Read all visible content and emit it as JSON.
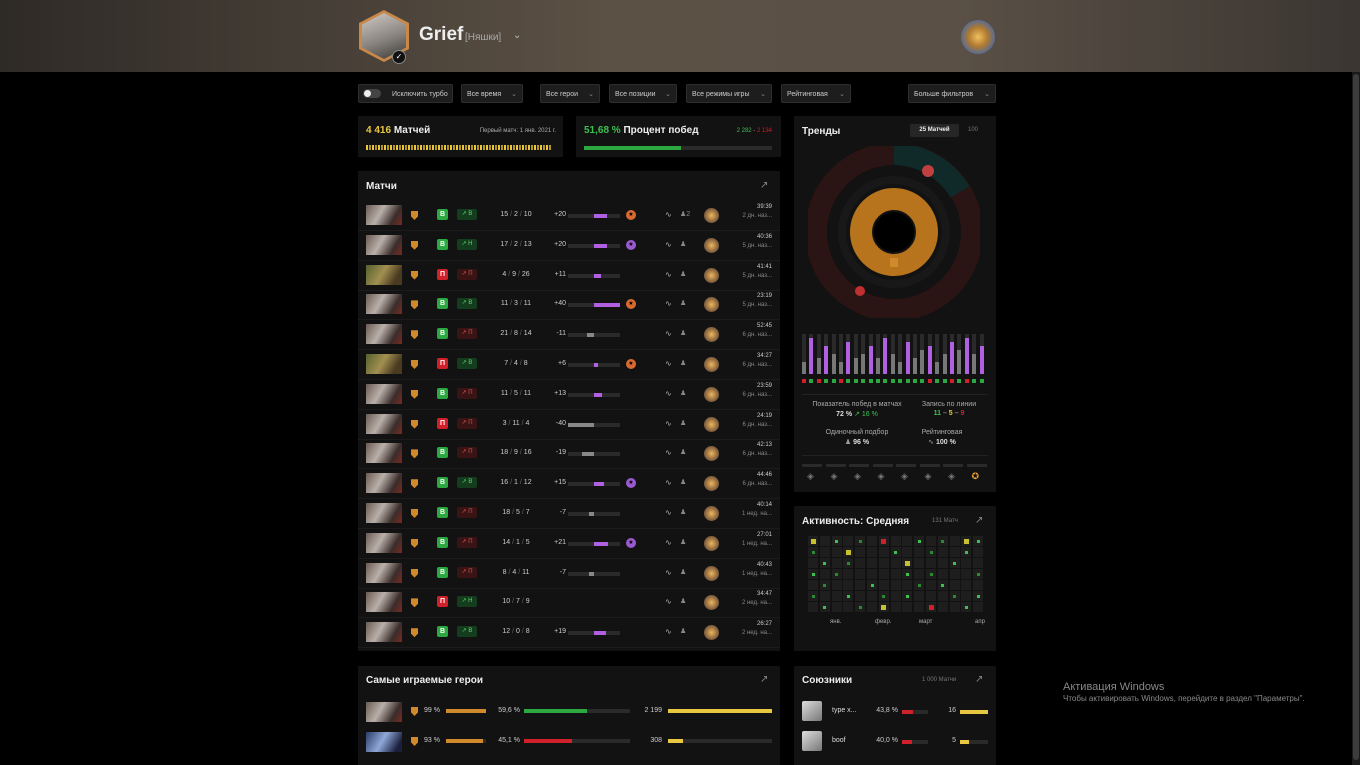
{
  "header": {
    "name": "Grief",
    "team": "[Няшки]"
  },
  "filters": {
    "turbo": "Исключить турбо",
    "time": "Все время",
    "heroes": "Все герои",
    "positions": "Все позиции",
    "modes": "Все режимы игры",
    "lobby": "Рейтинговая",
    "more": "Больше фильтров"
  },
  "summary": {
    "matches_count": "4 416",
    "matches_label": "Матчей",
    "first_match": "Первый матч: 1 янв. 2021 г.",
    "winrate": "51,68 %",
    "winrate_label": "Процент побед",
    "wins": "2 282",
    "losses": "2 134",
    "winrate_fraction": 0.5168
  },
  "matches": {
    "title": "Матчи",
    "rows": [
      {
        "hero": "p",
        "result": "В",
        "lane": "В",
        "lane_res": "w",
        "k": "15",
        "d": "2",
        "a": "10",
        "imp": "+20",
        "imp_value": 20,
        "badge": "#d86a30",
        "party": "2",
        "dur": "39:39",
        "ago": "2 дн. наз..."
      },
      {
        "hero": "p",
        "result": "В",
        "lane": "Н",
        "lane_res": "w",
        "k": "17",
        "d": "2",
        "a": "13",
        "imp": "+20",
        "imp_value": 20,
        "badge": "#9b59d0",
        "party": "",
        "dur": "40:36",
        "ago": "5 дн. наз..."
      },
      {
        "hero": "g",
        "result": "П",
        "lane": "П",
        "lane_res": "l",
        "k": "4",
        "d": "9",
        "a": "26",
        "imp": "+11",
        "imp_value": 11,
        "badge": "",
        "party": "",
        "dur": "41:41",
        "ago": "5 дн. наз..."
      },
      {
        "hero": "p",
        "result": "В",
        "lane": "В",
        "lane_res": "w",
        "k": "11",
        "d": "3",
        "a": "11",
        "imp": "+40",
        "imp_value": 40,
        "badge": "#d86a30",
        "party": "",
        "dur": "23:19",
        "ago": "5 дн. наз..."
      },
      {
        "hero": "p",
        "result": "В",
        "lane": "П",
        "lane_res": "l",
        "k": "21",
        "d": "8",
        "a": "14",
        "imp": "-11",
        "imp_value": -11,
        "badge": "",
        "party": "",
        "dur": "52:45",
        "ago": "6 дн. наз..."
      },
      {
        "hero": "g",
        "result": "П",
        "lane": "В",
        "lane_res": "w",
        "k": "7",
        "d": "4",
        "a": "8",
        "imp": "+6",
        "imp_value": 6,
        "badge": "#d86a30",
        "party": "",
        "dur": "34:27",
        "ago": "6 дн. наз..."
      },
      {
        "hero": "p",
        "result": "В",
        "lane": "П",
        "lane_res": "l",
        "k": "11",
        "d": "5",
        "a": "11",
        "imp": "+13",
        "imp_value": 13,
        "badge": "",
        "party": "",
        "dur": "23:59",
        "ago": "6 дн. наз..."
      },
      {
        "hero": "p",
        "result": "П",
        "lane": "П",
        "lane_res": "l",
        "k": "3",
        "d": "11",
        "a": "4",
        "imp": "-40",
        "imp_value": -40,
        "badge": "",
        "party": "",
        "dur": "24:19",
        "ago": "6 дн. наз..."
      },
      {
        "hero": "p",
        "result": "В",
        "lane": "П",
        "lane_res": "l",
        "k": "18",
        "d": "9",
        "a": "16",
        "imp": "-19",
        "imp_value": -19,
        "badge": "",
        "party": "",
        "dur": "42:13",
        "ago": "6 дн. наз..."
      },
      {
        "hero": "p",
        "result": "В",
        "lane": "В",
        "lane_res": "w",
        "k": "16",
        "d": "1",
        "a": "12",
        "imp": "+15",
        "imp_value": 15,
        "badge": "#9b59d0",
        "party": "",
        "dur": "44:46",
        "ago": "6 дн. наз..."
      },
      {
        "hero": "p",
        "result": "В",
        "lane": "П",
        "lane_res": "l",
        "k": "18",
        "d": "5",
        "a": "7",
        "imp": "-7",
        "imp_value": -7,
        "badge": "",
        "party": "",
        "dur": "40:14",
        "ago": "1 нед. на..."
      },
      {
        "hero": "p",
        "result": "В",
        "lane": "П",
        "lane_res": "l",
        "k": "14",
        "d": "1",
        "a": "5",
        "imp": "+21",
        "imp_value": 21,
        "badge": "#9b59d0",
        "party": "",
        "dur": "27:01",
        "ago": "1 нед. на..."
      },
      {
        "hero": "p",
        "result": "В",
        "lane": "П",
        "lane_res": "l",
        "k": "8",
        "d": "4",
        "a": "11",
        "imp": "-7",
        "imp_value": -7,
        "badge": "",
        "party": "",
        "dur": "40:43",
        "ago": "1 нед. на..."
      },
      {
        "hero": "p",
        "result": "П",
        "lane": "Н",
        "lane_res": "w",
        "k": "10",
        "d": "7",
        "a": "9",
        "imp": "",
        "imp_value": 0,
        "badge": "",
        "party": "",
        "dur": "34:47",
        "ago": "2 нед. на..."
      },
      {
        "hero": "p",
        "result": "В",
        "lane": "В",
        "lane_res": "w",
        "k": "12",
        "d": "0",
        "a": "8",
        "imp": "+19",
        "imp_value": 19,
        "badge": "",
        "party": "",
        "dur": "26:27",
        "ago": "2 нед. на..."
      }
    ]
  },
  "heroes": {
    "title": "Самые играемые герои",
    "rows": [
      {
        "hero": "p",
        "pct": "99 %",
        "pct_value": 0.99,
        "wr": "59,6 %",
        "wr_value": 0.596,
        "wr_color": "#2ba840",
        "count": "2 199",
        "count_frac": 1.0
      },
      {
        "hero": "b",
        "pct": "93 %",
        "pct_value": 0.93,
        "wr": "45,1 %",
        "wr_value": 0.451,
        "wr_color": "#d0202a",
        "count": "308",
        "count_frac": 0.14
      }
    ]
  },
  "trends": {
    "title": "Тренды",
    "tab_active": "25 Матчей",
    "tab_other": "100",
    "winrate_label": "Показатель побед в матчах",
    "winrate_value": "72 %",
    "winrate_delta": "16 %",
    "lane_label": "Запись по линии",
    "lane_w": "11",
    "lane_d": "5",
    "lane_l": "9",
    "solo_label": "Одиночный подбор",
    "solo_value": "96 %",
    "ranked_label": "Рейтинговая",
    "ranked_value": "100 %",
    "bars": [
      0.3,
      0.9,
      0.4,
      0.7,
      0.5,
      0.3,
      0.8,
      0.4,
      0.5,
      0.7,
      0.4,
      0.9,
      0.5,
      0.3,
      0.8,
      0.4,
      0.6,
      0.7,
      0.3,
      0.5,
      0.8,
      0.6,
      0.9,
      0.5,
      0.7
    ],
    "results": [
      "l",
      "w",
      "l",
      "w",
      "w",
      "l",
      "w",
      "w",
      "w",
      "w",
      "w",
      "w",
      "w",
      "w",
      "w",
      "w",
      "w",
      "l",
      "w",
      "w",
      "l",
      "w",
      "l",
      "w",
      "w"
    ]
  },
  "activity": {
    "title": "Активность: Средняя",
    "count": "131 Матч",
    "months": [
      "янв.",
      "февр.",
      "март",
      "апр"
    ]
  },
  "allies": {
    "title": "Союзники",
    "count": "1 000 Матчи",
    "rows": [
      {
        "name": "type x...",
        "wr": "43,8 %",
        "wr_value": 0.438,
        "count": "16",
        "count_frac": 1.0
      },
      {
        "name": "boof",
        "wr": "40,0 %",
        "wr_value": 0.4,
        "count": "5",
        "count_frac": 0.31
      }
    ]
  },
  "windows": {
    "line1": "Активация Windows",
    "line2": "Чтобы активировать Windows, перейдите в раздел \"Параметры\"."
  }
}
